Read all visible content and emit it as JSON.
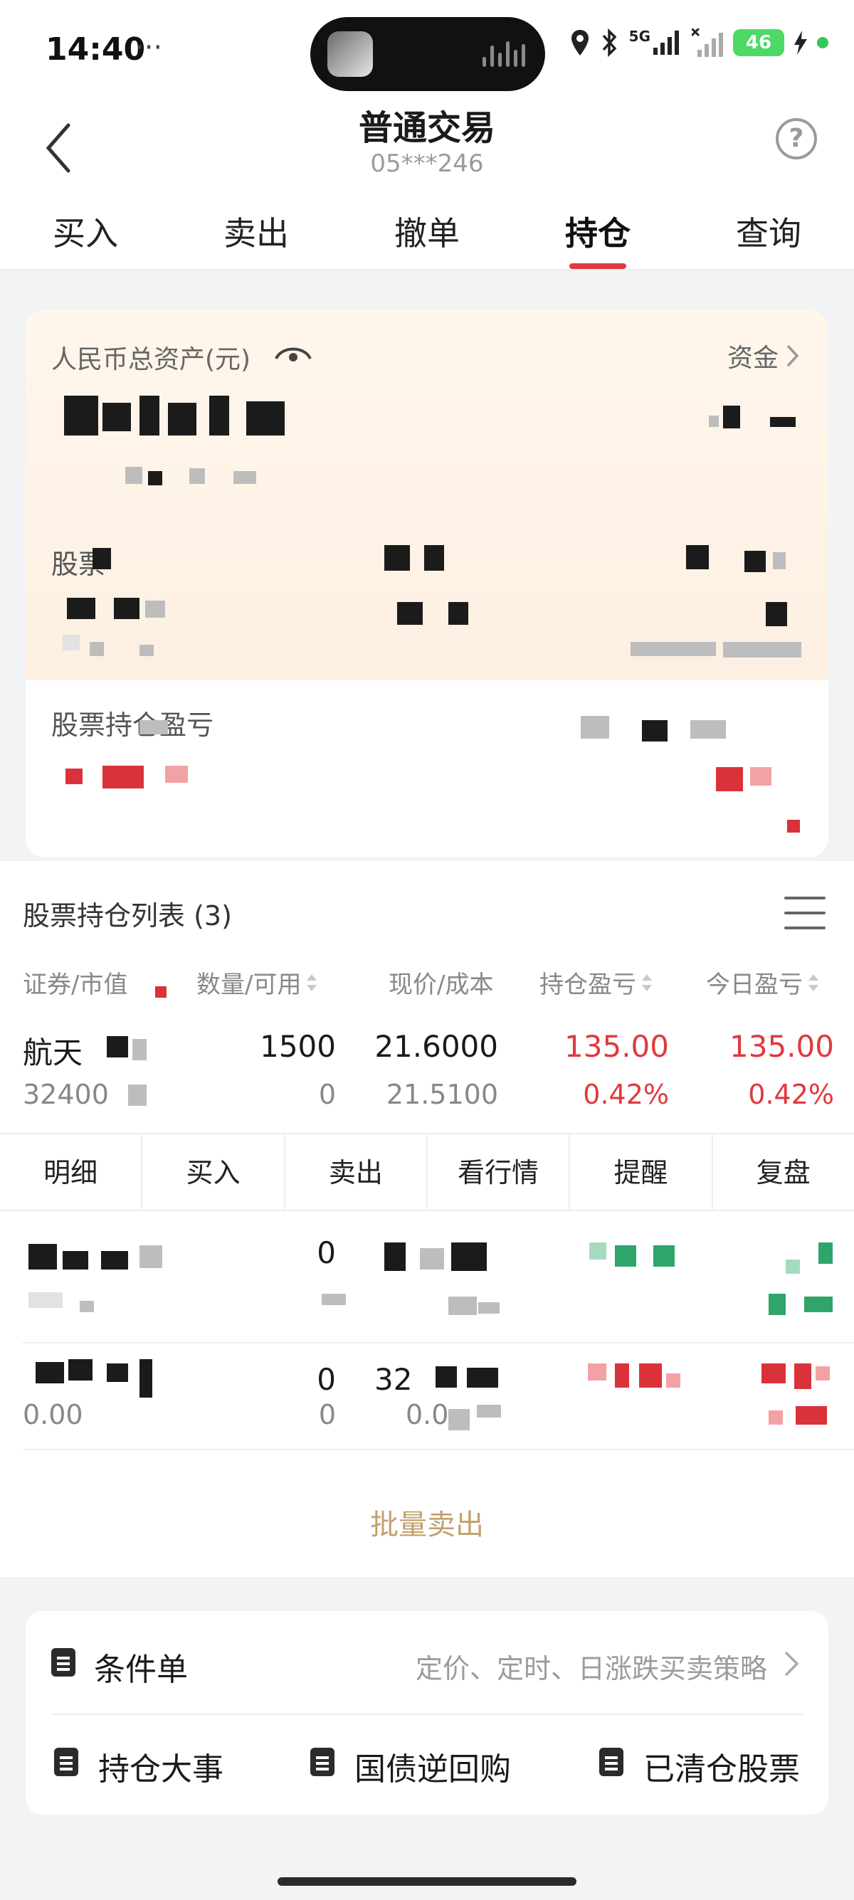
{
  "status_bar": {
    "time": "14:40",
    "extra": "···",
    "network": "5G",
    "battery": "46"
  },
  "header": {
    "title": "普通交易",
    "account": "05***246",
    "help_symbol": "?"
  },
  "tabs": [
    {
      "label": "买入"
    },
    {
      "label": "卖出"
    },
    {
      "label": "撤单"
    },
    {
      "label": "持仓"
    },
    {
      "label": "查询"
    }
  ],
  "asset_card": {
    "total_assets_label": "人民币总资产(元)",
    "funds_link": "资金",
    "stock_label": "股票",
    "position_profit_label": "股票持仓盈亏"
  },
  "holdings": {
    "title": "股票持仓列表 (3)",
    "columns": [
      "证券/市值",
      "数量/可用",
      "现价/成本",
      "持仓盈亏",
      "今日盈亏"
    ],
    "first_row": {
      "name": "航天",
      "market_value": "32400",
      "quantity": "1500",
      "available": "0",
      "price": "21.6000",
      "cost": "21.5100",
      "position_pl": "135.00",
      "position_pl_pct": "0.42%",
      "today_pl": "135.00",
      "today_pl_pct": "0.42%"
    },
    "actions": [
      "明细",
      "买入",
      "卖出",
      "看行情",
      "提醒",
      "复盘"
    ],
    "second_row": {
      "quantity": "0"
    },
    "third_row": {
      "quantity": "0",
      "available": "0",
      "price": "32",
      "market_value": "0.00",
      "cost": "0.0"
    },
    "batch_sell": "批量卖出"
  },
  "tools": {
    "conditional_label": "条件单",
    "conditional_desc": "定价、定时、日涨跌买卖策略",
    "items": [
      "持仓大事",
      "国债逆回购",
      "已清仓股票"
    ]
  },
  "colors": {
    "accent_red": "#e0393e",
    "gold": "#c2a16d"
  }
}
